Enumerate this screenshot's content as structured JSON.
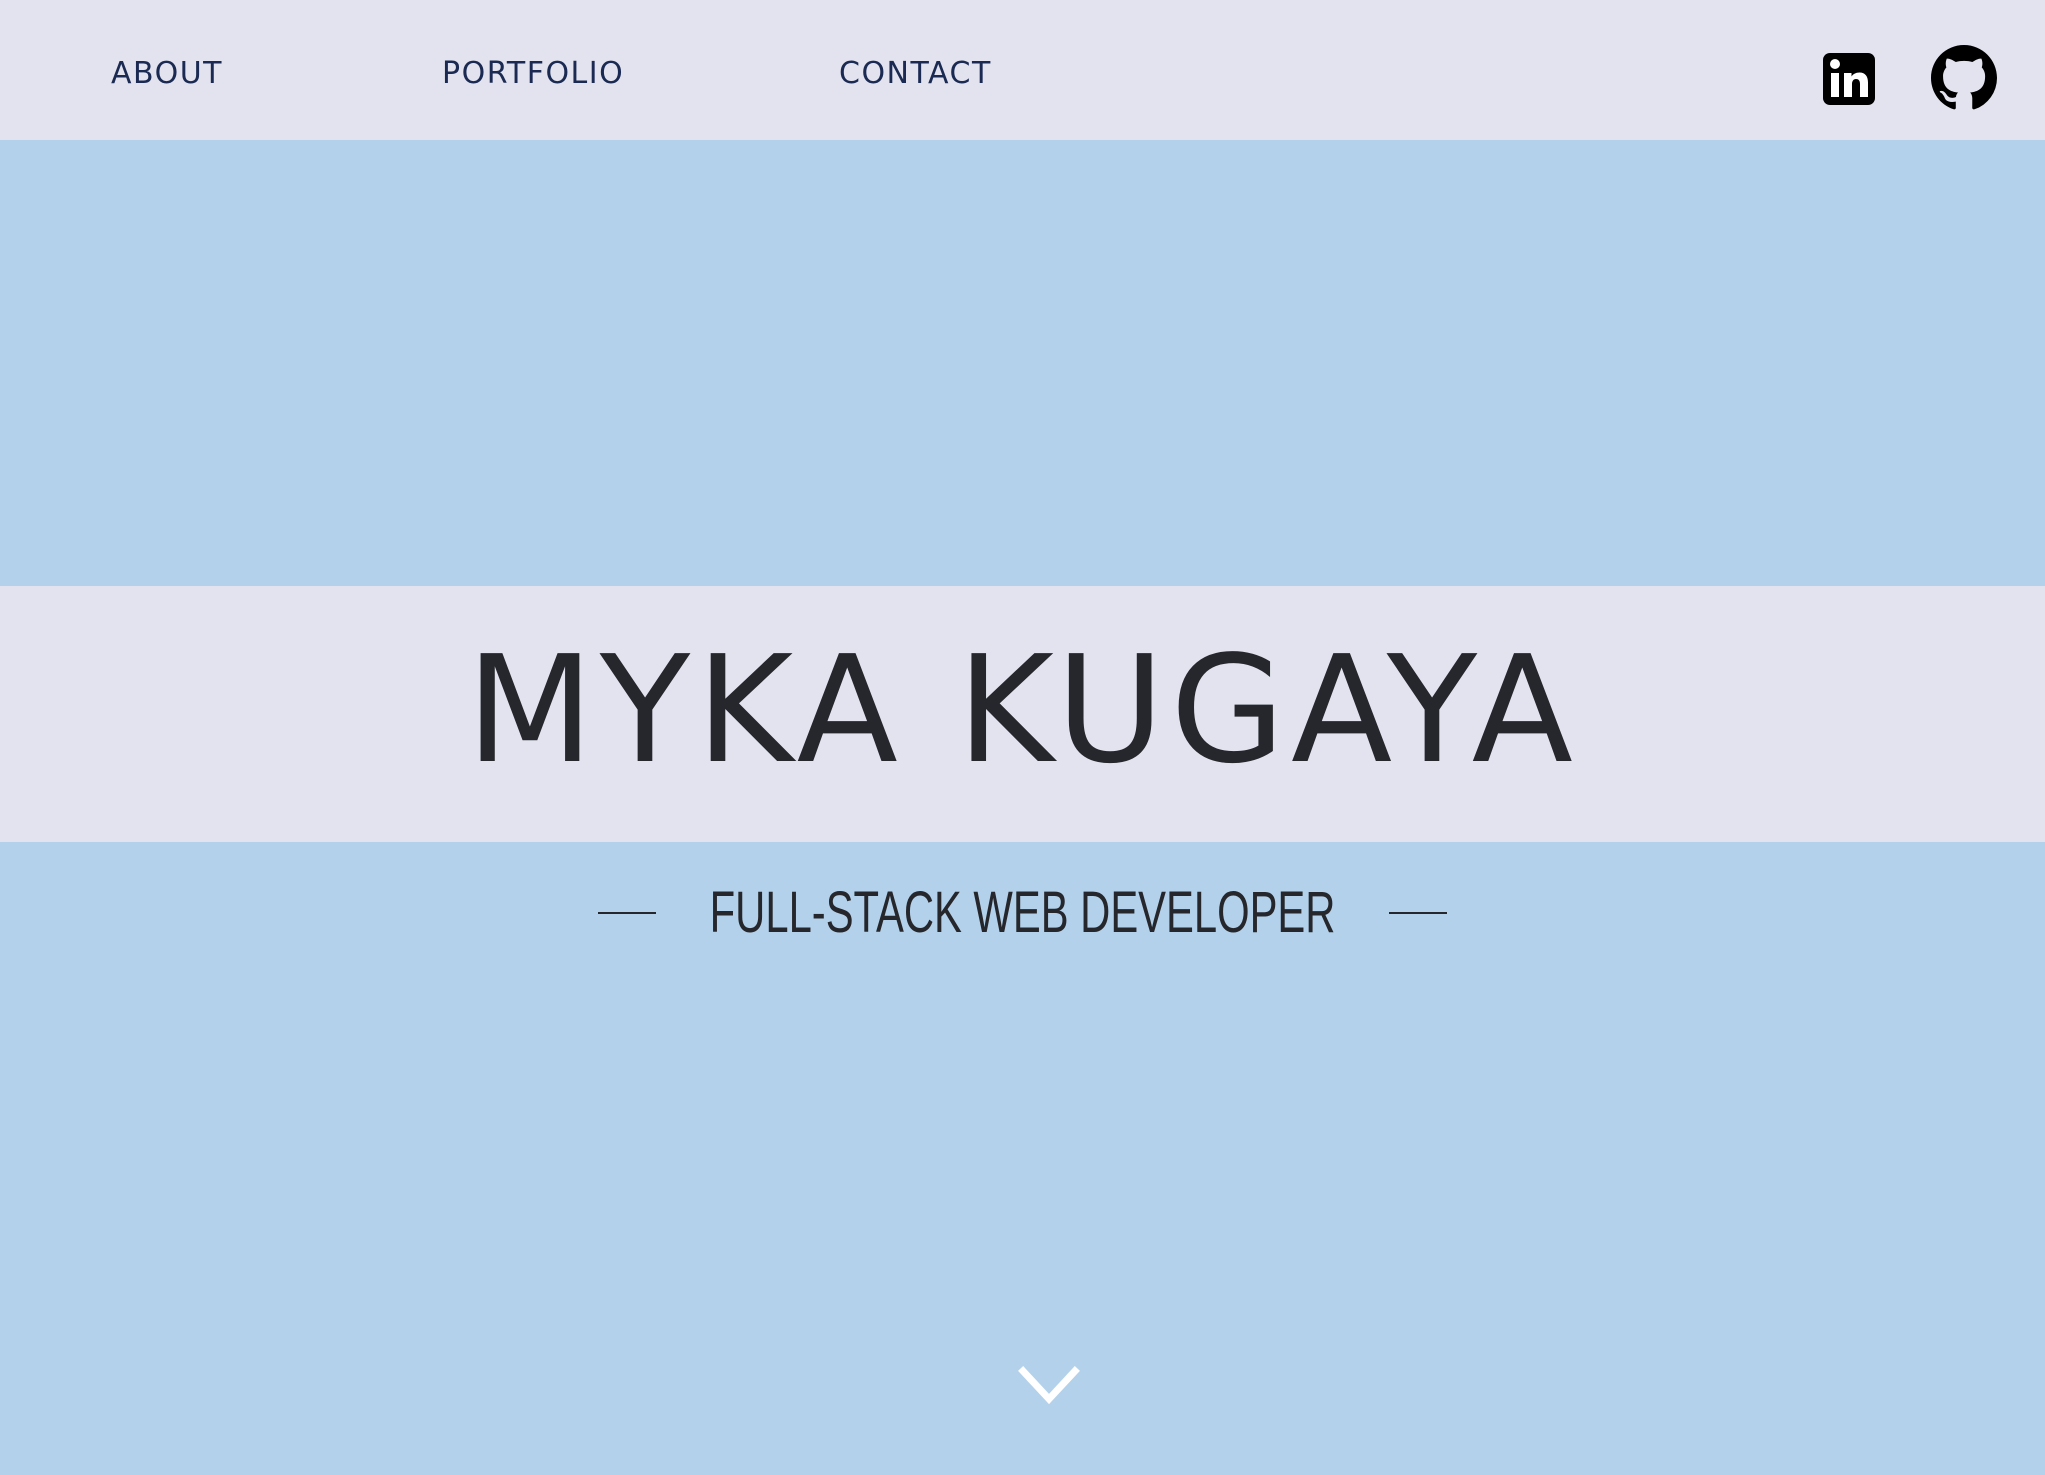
{
  "nav": {
    "about": "ABOUT",
    "portfolio": "PORTFOLIO",
    "contact": "CONTACT"
  },
  "social": {
    "linkedin_icon": "linkedin-icon",
    "github_icon": "github-icon"
  },
  "hero": {
    "name": "MYKA KUGAYA",
    "subtitle": "FULL-STACK WEB DEVELOPER",
    "scroll_icon": "chevron-down-icon"
  },
  "colors": {
    "background": "#b3d1ea",
    "band": "#e2e3ee",
    "nav_text": "#1b2a52",
    "title_text": "#25272c",
    "chevron": "#ffffff"
  }
}
